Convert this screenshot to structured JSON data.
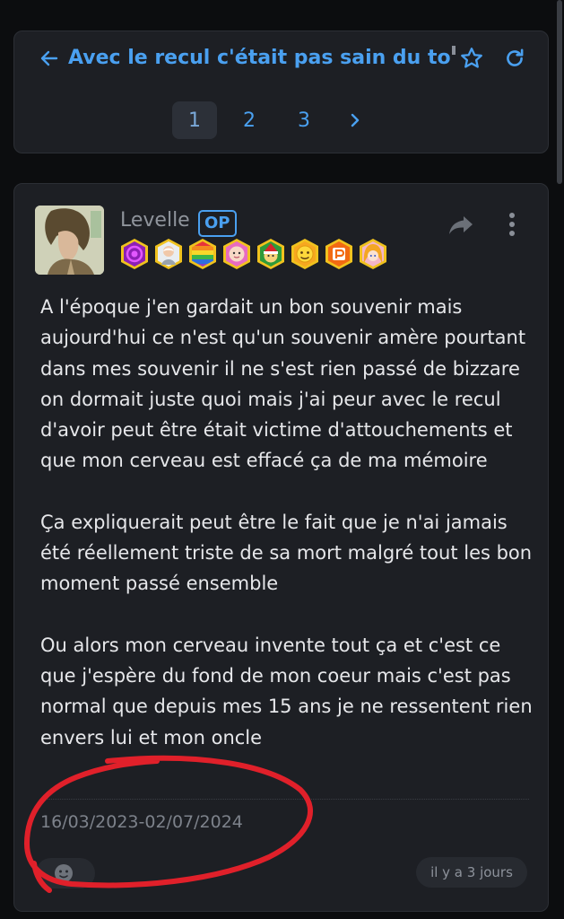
{
  "topic": {
    "title": "Avec le recul c'était pas sain du tout q",
    "icons": [
      "back-arrow-icon",
      "star-icon",
      "refresh-icon"
    ],
    "pagination": {
      "pages": [
        "1",
        "2",
        "3"
      ],
      "current": "1",
      "next_icon": "chevron-right-icon"
    }
  },
  "post": {
    "author": "Levelle",
    "op_label": "OP",
    "badges": [
      "spiral-badge",
      "old-man-badge",
      "rainbow-badge",
      "baby-face-badge",
      "christmas-badge",
      "yellow-emoji-badge",
      "orange-p-badge",
      "anime-girl-badge"
    ],
    "paragraphs": [
      "A l'époque j'en gardait un bon souvenir mais aujourd'hui ce n'est qu'un souvenir amère pourtant dans mes souvenir il ne s'est rien passé de bizzare on dormait juste quoi mais j'ai peur avec le recul d'avoir peut être était victime d'attouchements et que mon cerveau est effacé ça de ma mémoire",
      "Ça expliquerait peut être le fait que je n'ai jamais été réellement triste de sa mort malgré tout les bon moment passé ensemble",
      "Ou alors mon cerveau invente tout ça et c'est ce que j'espère du fond de mon coeur mais c'est pas normal que depuis mes 15 ans je ne ressentent rien envers lui et mon oncle"
    ],
    "date": "16/03/2023-02/07/2024",
    "time_ago": "il y a 3 jours"
  },
  "colors": {
    "accent": "#4aa0f0",
    "background": "#0c0d0f",
    "card": "#1d1f24",
    "annotation": "#e0202a"
  }
}
